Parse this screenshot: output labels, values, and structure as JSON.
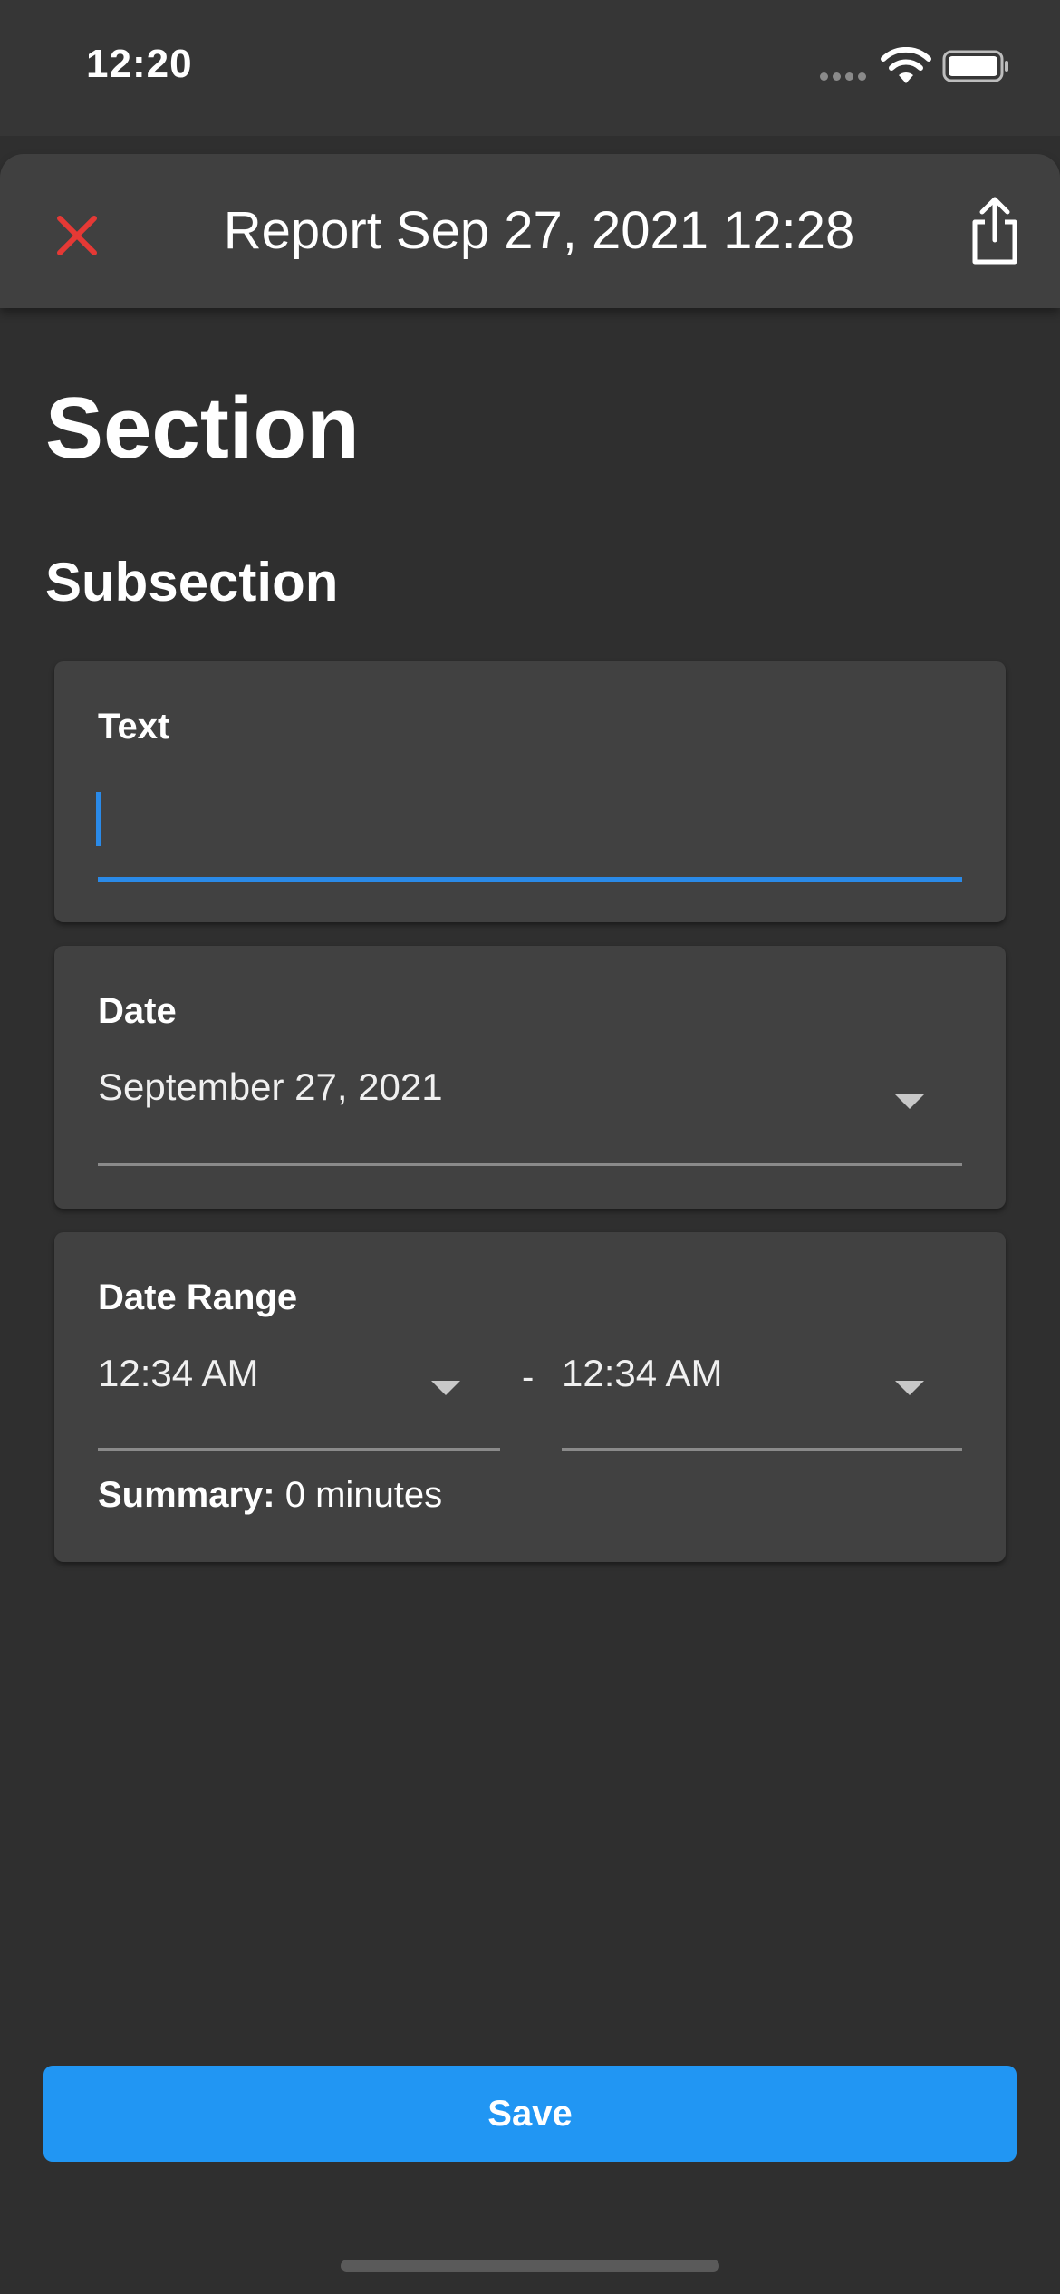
{
  "status_bar": {
    "time": "12:20"
  },
  "header": {
    "title": "Report Sep 27, 2021 12:28"
  },
  "section": {
    "title": "Section"
  },
  "subsection": {
    "title": "Subsection"
  },
  "text_card": {
    "label": "Text",
    "value": ""
  },
  "date_card": {
    "label": "Date",
    "value": "September 27, 2021"
  },
  "date_range_card": {
    "label": "Date Range",
    "start": "12:34 AM",
    "separator": "-",
    "end": "12:34 AM",
    "summary_label": "Summary:",
    "summary_value": "0 minutes"
  },
  "save_label": "Save",
  "colors": {
    "accent": "#2196f3",
    "close": "#e53935",
    "background": "#2f2f2f",
    "card": "#414141"
  },
  "icons": {
    "close": "close-icon",
    "share": "share-icon",
    "dropdown": "chevron-down-icon"
  }
}
